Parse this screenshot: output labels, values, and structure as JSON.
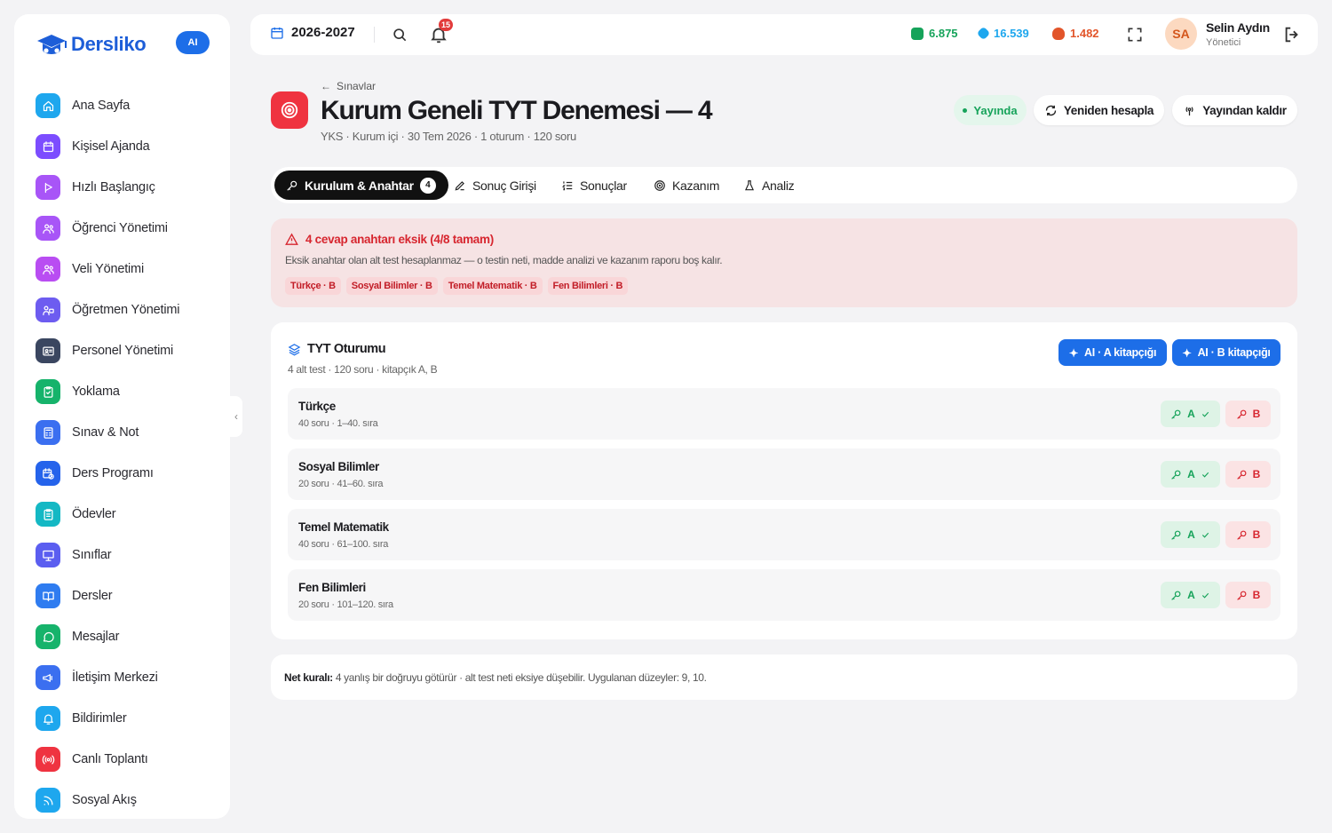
{
  "brand": {
    "name": "Dersliko",
    "ai_badge": "AI"
  },
  "sidebar": {
    "items": [
      {
        "label": "Ana Sayfa",
        "icon": "home-icon",
        "color": "#1ea7ee"
      },
      {
        "label": "Kişisel Ajanda",
        "icon": "calendar-icon",
        "color": "#7c4dff"
      },
      {
        "label": "Hızlı Başlangıç",
        "icon": "play-icon",
        "color": "#a855f7"
      },
      {
        "label": "Öğrenci Yönetimi",
        "icon": "users-icon",
        "color": "#a855f7"
      },
      {
        "label": "Veli Yönetimi",
        "icon": "users-icon",
        "color": "#b94df2"
      },
      {
        "label": "Öğretmen Yönetimi",
        "icon": "teacher-icon",
        "color": "#6d5cf0"
      },
      {
        "label": "Personel Yönetimi",
        "icon": "id-card-icon",
        "color": "#3a4660"
      },
      {
        "label": "Yoklama",
        "icon": "clipboard-check-icon",
        "color": "#16b36b"
      },
      {
        "label": "Sınav & Not",
        "icon": "calculator-icon",
        "color": "#3b6ff0"
      },
      {
        "label": "Ders Programı",
        "icon": "calendar-clock-icon",
        "color": "#2563eb"
      },
      {
        "label": "Ödevler",
        "icon": "clipboard-list-icon",
        "color": "#14b8c4"
      },
      {
        "label": "Sınıflar",
        "icon": "presentation-icon",
        "color": "#5b5ef0"
      },
      {
        "label": "Dersler",
        "icon": "book-open-icon",
        "color": "#2f7cf0"
      },
      {
        "label": "Mesajlar",
        "icon": "message-circle-icon",
        "color": "#16b36b"
      },
      {
        "label": "İletişim Merkezi",
        "icon": "megaphone-icon",
        "color": "#3b6ff0"
      },
      {
        "label": "Bildirimler",
        "icon": "bell-icon",
        "color": "#1ea7ee"
      },
      {
        "label": "Canlı Toplantı",
        "icon": "broadcast-icon",
        "color": "#ef3340"
      },
      {
        "label": "Sosyal Akış",
        "icon": "rss-icon",
        "color": "#1ea7ee"
      }
    ]
  },
  "topbar": {
    "year": "2026-2027",
    "notifications": "15",
    "stats": [
      {
        "value": "6.875",
        "color": "#16a35a",
        "icon": "coin-icon"
      },
      {
        "value": "16.539",
        "color": "#1ea7ee",
        "icon": "gem-icon"
      },
      {
        "value": "1.482",
        "color": "#e2552a",
        "icon": "flame-icon"
      }
    ],
    "user": {
      "initials": "SA",
      "name": "Selin Aydın",
      "role": "Yönetici"
    }
  },
  "header": {
    "breadcrumb": "Sınavlar",
    "title": "Kurum Geneli TYT Denemesi — 4",
    "subtitle": "YKS · Kurum içi · 30 Tem 2026 · 1 oturum · 120 soru",
    "status": "Yayında",
    "recalc_label": "Yeniden hesapla",
    "unpublish_label": "Yayından kaldır"
  },
  "tabs": [
    {
      "label": "Kurulum & Anahtar",
      "count": "4",
      "icon": "key-icon"
    },
    {
      "label": "Sonuç Girişi",
      "icon": "pencil-icon"
    },
    {
      "label": "Sonuçlar",
      "icon": "list-ordered-icon"
    },
    {
      "label": "Kazanım",
      "icon": "target-icon"
    },
    {
      "label": "Analiz",
      "icon": "flask-icon"
    }
  ],
  "alert": {
    "title": "4 cevap anahtarı eksik (4/8 tamam)",
    "description": "Eksik anahtar olan alt test hesaplanmaz — o testin neti, madde analizi ve kazanım raporu boş kalır.",
    "tags": [
      "Türkçe · B",
      "Sosyal Bilimler · B",
      "Temel Matematik · B",
      "Fen Bilimleri · B"
    ]
  },
  "session": {
    "title": "TYT Oturumu",
    "subtitle": "4 alt test · 120 soru · kitapçık A, B",
    "ai_a_label": "AI · A kitapçığı",
    "ai_b_label": "AI · B kitapçığı",
    "subtests": [
      {
        "name": "Türkçe",
        "meta": "40 soru · 1–40. sıra",
        "key_a": "A",
        "key_b": "B"
      },
      {
        "name": "Sosyal Bilimler",
        "meta": "20 soru · 41–60. sıra",
        "key_a": "A",
        "key_b": "B"
      },
      {
        "name": "Temel Matematik",
        "meta": "40 soru · 61–100. sıra",
        "key_a": "A",
        "key_b": "B"
      },
      {
        "name": "Fen Bilimleri",
        "meta": "20 soru · 101–120. sıra",
        "key_a": "A",
        "key_b": "B"
      }
    ]
  },
  "note": {
    "label": "Net kuralı:",
    "text": "4 yanlış bir doğruyu götürür · alt test neti eksiye düşebilir. Uygulanan düzeyler: 9, 10."
  }
}
